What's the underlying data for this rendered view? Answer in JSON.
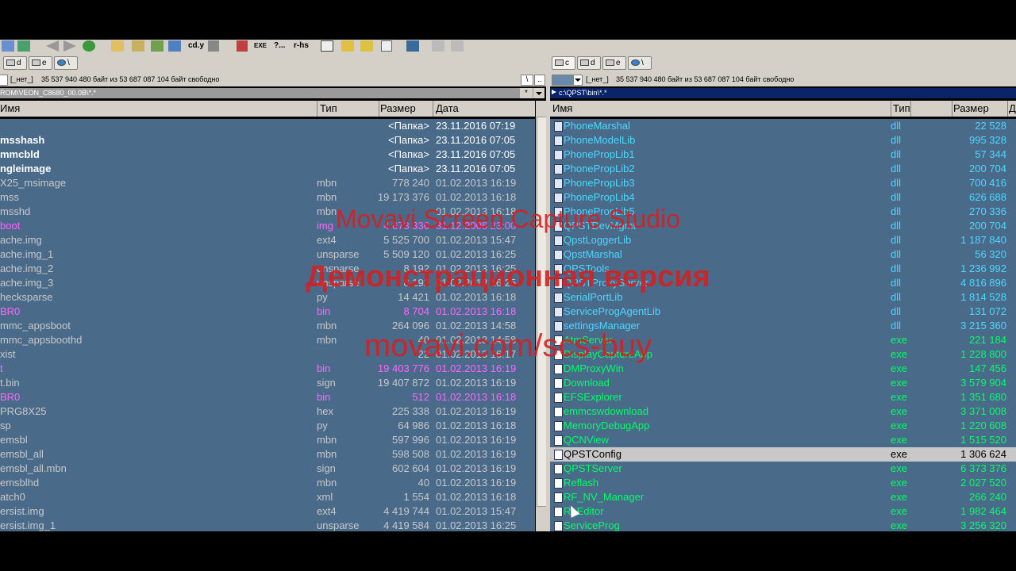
{
  "colors": {
    "dir": "#ffffff",
    "file": "#c8c8c8",
    "left_pink": "#ff66ff",
    "exe": "#00ff66",
    "dll": "#4ad8ff",
    "ext_blue": "#30b0ff",
    "selected_bg": "#c8c8c8",
    "selected_text": "#000000"
  },
  "toolbar": {
    "cmd_label": "cd.y",
    "exe_label": "EXE",
    "help_label": "?...",
    "rhs_label": "r-hs"
  },
  "left": {
    "drives": [
      "d",
      "e",
      "\\"
    ],
    "drive_label": "[_нет_]",
    "free_space": "35 537 940 480 байт из 53 687 087 104 байт свободно",
    "path": "ROM\\VEON_C8680_00.0B\\*.*",
    "columns": {
      "name": "Имя",
      "type": "Тип",
      "size": "Размер",
      "date": "Дата"
    },
    "rows": [
      {
        "name": "",
        "type": "",
        "size": "<Папка>",
        "date": "23.11.2016 07:19",
        "k": "dir"
      },
      {
        "name": "msshash",
        "type": "",
        "size": "<Папка>",
        "date": "23.11.2016 07:05",
        "k": "dir"
      },
      {
        "name": "mmcbld",
        "type": "",
        "size": "<Папка>",
        "date": "23.11.2016 07:05",
        "k": "dir"
      },
      {
        "name": "ngleimage",
        "type": "",
        "size": "<Папка>",
        "date": "23.11.2016 07:05",
        "k": "dir"
      },
      {
        "name": "X25_msimage",
        "type": "mbn",
        "size": "778 240",
        "date": "01.02.2013 16:19",
        "k": "file"
      },
      {
        "name": "mss",
        "type": "mbn",
        "size": "19 173 376",
        "date": "01.02.2013 16:18",
        "k": "file"
      },
      {
        "name": "msshd",
        "type": "mbn",
        "size": "",
        "date": "01.02.2013 16:18",
        "k": "file"
      },
      {
        "name": "boot",
        "type": "img",
        "size": "4 673 336",
        "date": "31.12.2008 23:00",
        "k": "pink"
      },
      {
        "name": "ache.img",
        "type": "ext4",
        "size": "5 525 700",
        "date": "01.02.2013 15:47",
        "k": "file"
      },
      {
        "name": "ache.img_1",
        "type": "unsparse",
        "size": "5 509 120",
        "date": "01.02.2013 16:25",
        "k": "file"
      },
      {
        "name": "ache.img_2",
        "type": "unsparse",
        "size": "8 192",
        "date": "01.02.2013 16:25",
        "k": "file"
      },
      {
        "name": "ache.img_3",
        "type": "unsparse",
        "size": "8 192",
        "date": "01.02.2013 16:25",
        "k": "file"
      },
      {
        "name": "hecksparse",
        "type": "py",
        "size": "14 421",
        "date": "01.02.2013 16:18",
        "k": "file"
      },
      {
        "name": "BR0",
        "type": "bin",
        "size": "8 704",
        "date": "01.02.2013 16:18",
        "k": "pink"
      },
      {
        "name": "mmc_appsboot",
        "type": "mbn",
        "size": "264 096",
        "date": "01.02.2013 14:58",
        "k": "file"
      },
      {
        "name": "mmc_appsboothd",
        "type": "mbn",
        "size": "40",
        "date": "01.02.2013 14:58",
        "k": "file"
      },
      {
        "name": "xist",
        "type": "",
        "size": "22",
        "date": "01.02.2013 16:17",
        "k": "file"
      },
      {
        "name": "t",
        "type": "bin",
        "size": "19 403 776",
        "date": "01.02.2013 16:19",
        "k": "pink"
      },
      {
        "name": "t.bin",
        "type": "sign",
        "size": "19 407 872",
        "date": "01.02.2013 16:19",
        "k": "file"
      },
      {
        "name": "BR0",
        "type": "bin",
        "size": "512",
        "date": "01.02.2013 16:18",
        "k": "pink"
      },
      {
        "name": "PRG8X25",
        "type": "hex",
        "size": "225 338",
        "date": "01.02.2013 16:19",
        "k": "file"
      },
      {
        "name": "sp",
        "type": "py",
        "size": "64 986",
        "date": "01.02.2013 16:18",
        "k": "file"
      },
      {
        "name": "emsbl",
        "type": "mbn",
        "size": "597 996",
        "date": "01.02.2013 16:19",
        "k": "file"
      },
      {
        "name": "emsbl_all",
        "type": "mbn",
        "size": "598 508",
        "date": "01.02.2013 16:19",
        "k": "file"
      },
      {
        "name": "emsbl_all.mbn",
        "type": "sign",
        "size": "602 604",
        "date": "01.02.2013 16:19",
        "k": "file"
      },
      {
        "name": "emsblhd",
        "type": "mbn",
        "size": "40",
        "date": "01.02.2013 16:19",
        "k": "file"
      },
      {
        "name": "atch0",
        "type": "xml",
        "size": "1 554",
        "date": "01.02.2013 16:18",
        "k": "file"
      },
      {
        "name": "ersist.img",
        "type": "ext4",
        "size": "4 419 744",
        "date": "01.02.2013 15:47",
        "k": "file"
      },
      {
        "name": "ersist.img_1",
        "type": "unsparse",
        "size": "4 419 584",
        "date": "01.02.2013 16:25",
        "k": "file"
      }
    ]
  },
  "right": {
    "drives": [
      "c",
      "d",
      "e",
      "\\"
    ],
    "drive_label": "[_нет_]",
    "free_space": "35 537 940 480 байт из 53 687 087 104 байт свободно",
    "path": "c:\\QPST\\bin\\*.*",
    "columns": {
      "name": "Имя",
      "type": "Тип",
      "size": "Размер",
      "date": "Д"
    },
    "rows": [
      {
        "name": "PhoneMarshal",
        "type": "dll",
        "size": "22 528",
        "k": "dll"
      },
      {
        "name": "PhoneModelLib",
        "type": "dll",
        "size": "995 328",
        "k": "dll"
      },
      {
        "name": "PhonePropLib1",
        "type": "dll",
        "size": "57 344",
        "k": "dll"
      },
      {
        "name": "PhonePropLib2",
        "type": "dll",
        "size": "200 704",
        "k": "dll"
      },
      {
        "name": "PhonePropLib3",
        "type": "dll",
        "size": "700 416",
        "k": "dll"
      },
      {
        "name": "PhonePropLib4",
        "type": "dll",
        "size": "626 688",
        "k": "dll"
      },
      {
        "name": "PhonePropLib5",
        "type": "dll",
        "size": "270 336",
        "k": "dll"
      },
      {
        "name": "QPSTDevMgmt",
        "type": "dll",
        "size": "200 704",
        "k": "dll"
      },
      {
        "name": "QpstLoggerLib",
        "type": "dll",
        "size": "1 187 840",
        "k": "dll"
      },
      {
        "name": "QpstMarshal",
        "type": "dll",
        "size": "56 320",
        "k": "dll"
      },
      {
        "name": "QPSTools",
        "type": "dll",
        "size": "1 236 992",
        "k": "dll"
      },
      {
        "name": "QPSTProxyServer",
        "type": "dll",
        "size": "4 816 896",
        "k": "dll"
      },
      {
        "name": "SerialPortLib",
        "type": "dll",
        "size": "1 814 528",
        "k": "dll"
      },
      {
        "name": "ServiceProgAgentLib",
        "type": "dll",
        "size": "131 072",
        "k": "dll"
      },
      {
        "name": "settingsManager",
        "type": "dll",
        "size": "3 215 360",
        "k": "dll"
      },
      {
        "name": "AtmServer",
        "type": "exe",
        "size": "221 184",
        "k": "exe"
      },
      {
        "name": "DisplayCaptureApp",
        "type": "exe",
        "size": "1 228 800",
        "k": "exe"
      },
      {
        "name": "DMProxyWin",
        "type": "exe",
        "size": "147 456",
        "k": "exe"
      },
      {
        "name": "Download",
        "type": "exe",
        "size": "3 579 904",
        "k": "exe"
      },
      {
        "name": "EFSExplorer",
        "type": "exe",
        "size": "1 351 680",
        "k": "exe"
      },
      {
        "name": "emmcswdownload",
        "type": "exe",
        "size": "3 371 008",
        "k": "exe"
      },
      {
        "name": "MemoryDebugApp",
        "type": "exe",
        "size": "1 220 608",
        "k": "exe"
      },
      {
        "name": "QCNView",
        "type": "exe",
        "size": "1 515 520",
        "k": "exe"
      },
      {
        "name": "QPSTConfig",
        "type": "exe",
        "size": "1 306 624",
        "k": "selected"
      },
      {
        "name": "QPSTServer",
        "type": "exe",
        "size": "6 373 376",
        "k": "exe"
      },
      {
        "name": "Reflash",
        "type": "exe",
        "size": "2 027 520",
        "k": "exe"
      },
      {
        "name": "RF_NV_Manager",
        "type": "exe",
        "size": "266 240",
        "k": "exe"
      },
      {
        "name": "RLEditor",
        "type": "exe",
        "size": "1 982 464",
        "k": "exe"
      },
      {
        "name": "ServiceProg",
        "type": "exe",
        "size": "3 256 320",
        "k": "exe"
      }
    ]
  },
  "watermark": {
    "line1": "Movavi Screen Capture Studio",
    "line2": "Демонстрационная версия",
    "line3": "movavi.com/scs-buy"
  }
}
